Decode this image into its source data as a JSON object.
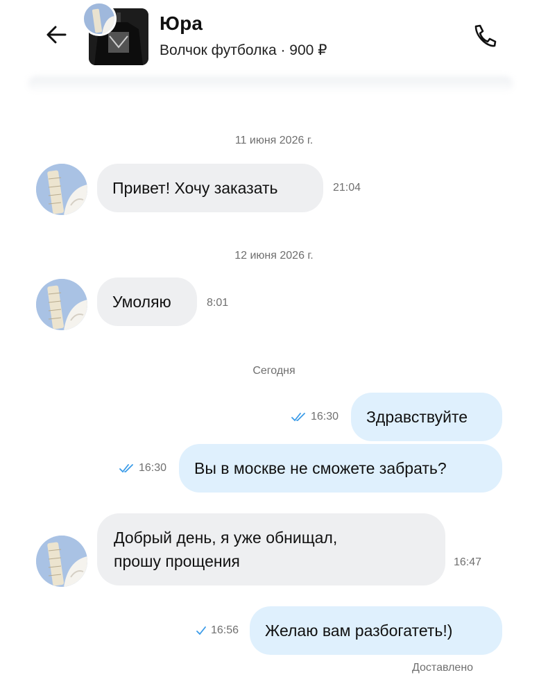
{
  "header": {
    "contact_name": "Юра",
    "product_line": "Волчок футболка · 900 ₽"
  },
  "messages": {
    "date1": "11 июня 2026 г.",
    "m1_text": "Привет! Хочу заказать",
    "m1_time": "21:04",
    "date2": "12 июня 2026 г.",
    "m2_text": "Умоляю",
    "m2_time": "8:01",
    "date3": "Сегодня",
    "m3_text": "Здравствуйте",
    "m3_time": "16:30",
    "m4_text": "Вы в москве не сможете забрать?",
    "m4_time": "16:30",
    "m5_line1": "Добрый день, я уже обнищал,",
    "m5_line2": "прошу прощения",
    "m5_time": "16:47",
    "m6_text": "Желаю вам разбогатеть!)",
    "m6_time": "16:56",
    "m6_status": "Доставлено"
  },
  "colors": {
    "incoming_bubble": "#eeeff1",
    "outgoing_bubble": "#dff0fd",
    "read_check": "#3a9be8"
  },
  "icons": {
    "back": "arrow-left-icon",
    "call": "phone-icon",
    "read": "double-check-icon",
    "sent": "single-check-icon"
  }
}
